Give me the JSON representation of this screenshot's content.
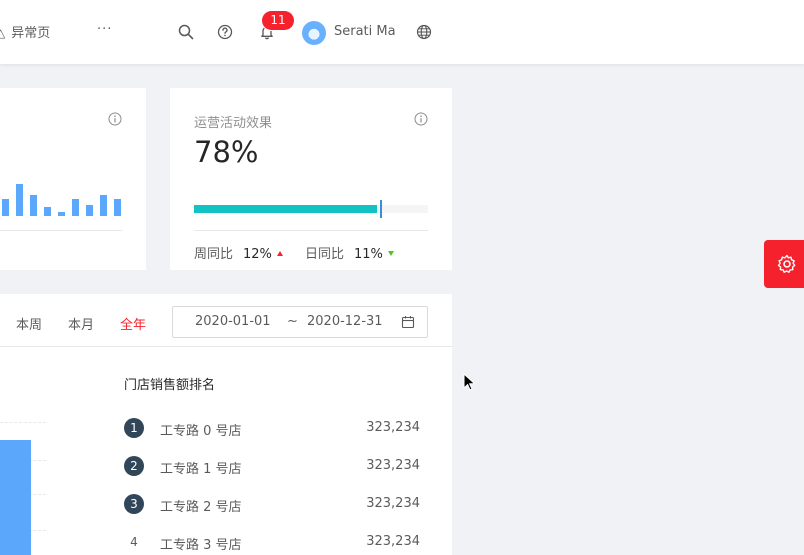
{
  "header": {
    "tab_label": "异常页",
    "more_label": "···",
    "notification_count": "11",
    "user_name": "Serati Ma",
    "icons": [
      "search-icon",
      "question-icon",
      "bell-icon",
      "globe-icon"
    ]
  },
  "cards": {
    "visits": {
      "spark_values": [
        8,
        15,
        10,
        4,
        2,
        8,
        5,
        10,
        8
      ]
    },
    "operations": {
      "title": "运营活动效果",
      "value": "78%",
      "progress_percent": 78,
      "week_label": "周同比",
      "week_value": "12%",
      "day_label": "日同比",
      "day_value": "11%"
    }
  },
  "sales": {
    "range_tabs": [
      "本周",
      "本月",
      "全年"
    ],
    "active_range": "全年",
    "date_start": "2020-01-01",
    "date_separator": "~",
    "date_end": "2020-12-31",
    "ranking_title": "门店销售额排名",
    "ranking": [
      {
        "index": "1",
        "name": "工专路 0 号店",
        "amount": "323,234"
      },
      {
        "index": "2",
        "name": "工专路 1 号店",
        "amount": "323,234"
      },
      {
        "index": "3",
        "name": "工专路 2 号店",
        "amount": "323,234"
      },
      {
        "index": "4",
        "name": "工专路 3 号店",
        "amount": "323,234"
      }
    ]
  },
  "colors": {
    "accent_red": "#f5222d",
    "progress": "#13c2c2",
    "bar_blue": "#5aa7fb",
    "rank_badge": "#314659"
  }
}
